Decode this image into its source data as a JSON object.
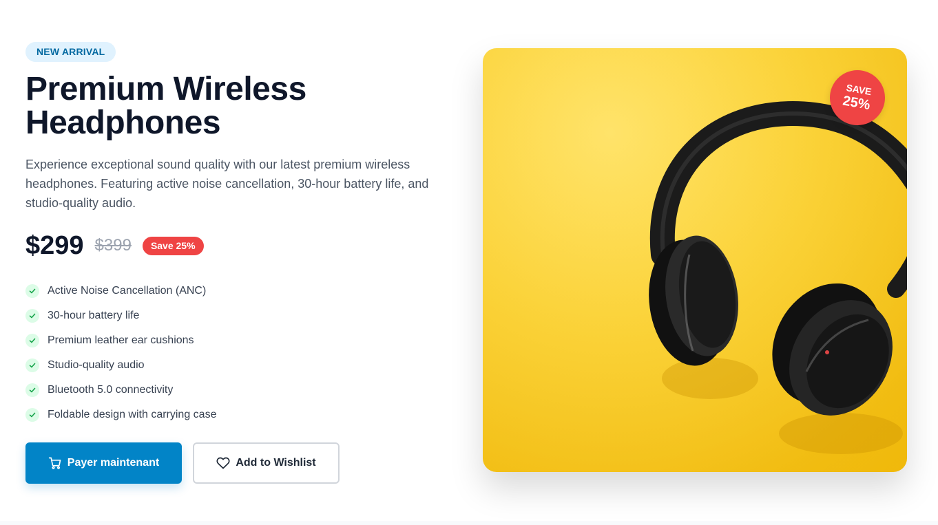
{
  "product": {
    "badge": "NEW ARRIVAL",
    "title": "Premium Wireless Headphones",
    "description": "Experience exceptional sound quality with our latest premium wireless headphones. Featuring active noise cancellation, 30-hour battery life, and studio-quality audio.",
    "price": "$299",
    "original_price": "$399",
    "save_label": "Save 25%",
    "features": [
      "Active Noise Cancellation (ANC)",
      "30-hour battery life",
      "Premium leather ear cushions",
      "Studio-quality audio",
      "Bluetooth 5.0 connectivity",
      "Foldable design with carrying case"
    ]
  },
  "actions": {
    "primary_label": "Payer maintenant",
    "primary_icon": "cart-icon",
    "secondary_label": "Add to Wishlist",
    "secondary_icon": "heart-icon"
  },
  "image_badge": {
    "line1": "SAVE",
    "line2": "25%"
  },
  "colors": {
    "accent": "#0284c7",
    "sale": "#ef4444",
    "badge_bg": "#e0f2fe",
    "check": "#16a34a",
    "image_bg": "#fcd438"
  }
}
